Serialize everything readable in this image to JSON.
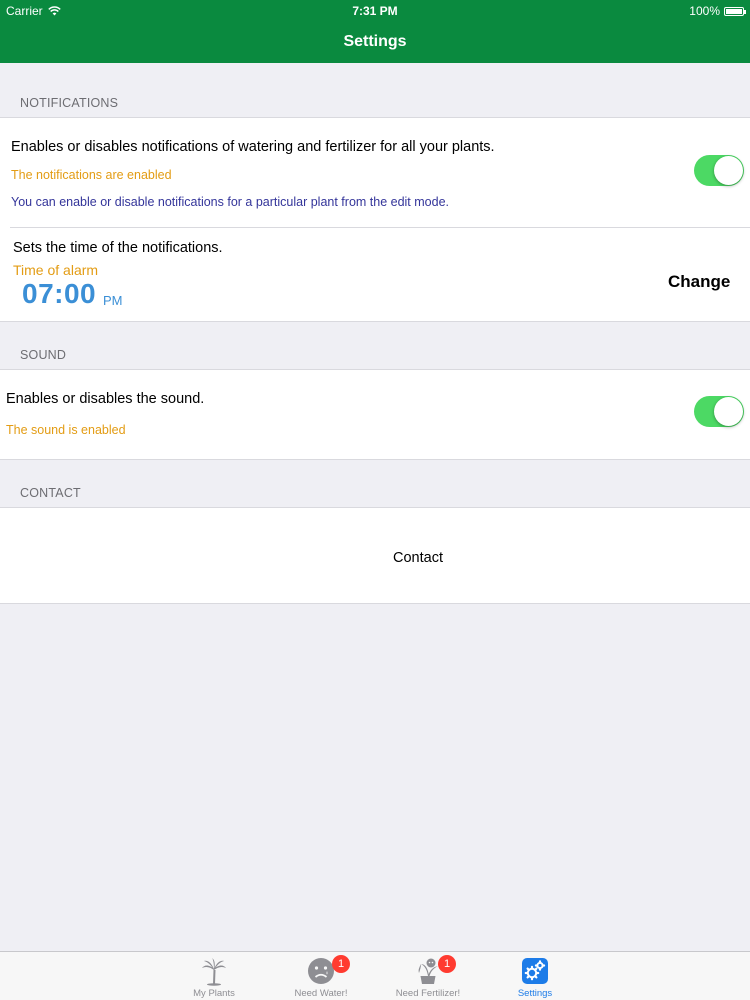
{
  "status_bar": {
    "carrier": "Carrier",
    "time": "7:31 PM",
    "battery": "100%"
  },
  "nav": {
    "title": "Settings"
  },
  "notifications": {
    "header": "NOTIFICATIONS",
    "description": "Enables or disables notifications of watering and fertilizer for all your plants.",
    "status": "The notifications are enabled",
    "hint": "You can enable or disable notifications for a particular plant from the edit mode.",
    "toggle_on": true,
    "time_description": "Sets the time of the notifications.",
    "time_label": "Time of alarm",
    "time_value": "07:00",
    "time_period": "PM",
    "change_label": "Change"
  },
  "sound": {
    "header": "SOUND",
    "description": "Enables or disables the sound.",
    "status": "The sound is enabled",
    "toggle_on": true
  },
  "contact": {
    "header": "CONTACT",
    "button_label": "Contact"
  },
  "tabbar": {
    "tabs": [
      {
        "label": "My Plants",
        "icon": "palm-tree-icon",
        "badge": ""
      },
      {
        "label": "Need Water!",
        "icon": "sad-face-icon",
        "badge": "1"
      },
      {
        "label": "Need Fertilizer!",
        "icon": "wilted-plant-icon",
        "badge": "1"
      },
      {
        "label": "Settings",
        "icon": "gear-icon",
        "badge": ""
      }
    ],
    "active_index": 3
  },
  "colors": {
    "nav_green": "#0a8a3f",
    "toggle_green": "#4cd964",
    "status_orange": "#e39c14",
    "hint_blue": "#34359a",
    "time_blue": "#3b8fd6",
    "tab_active_blue": "#1d7ce8",
    "badge_red": "#ff3b30"
  }
}
